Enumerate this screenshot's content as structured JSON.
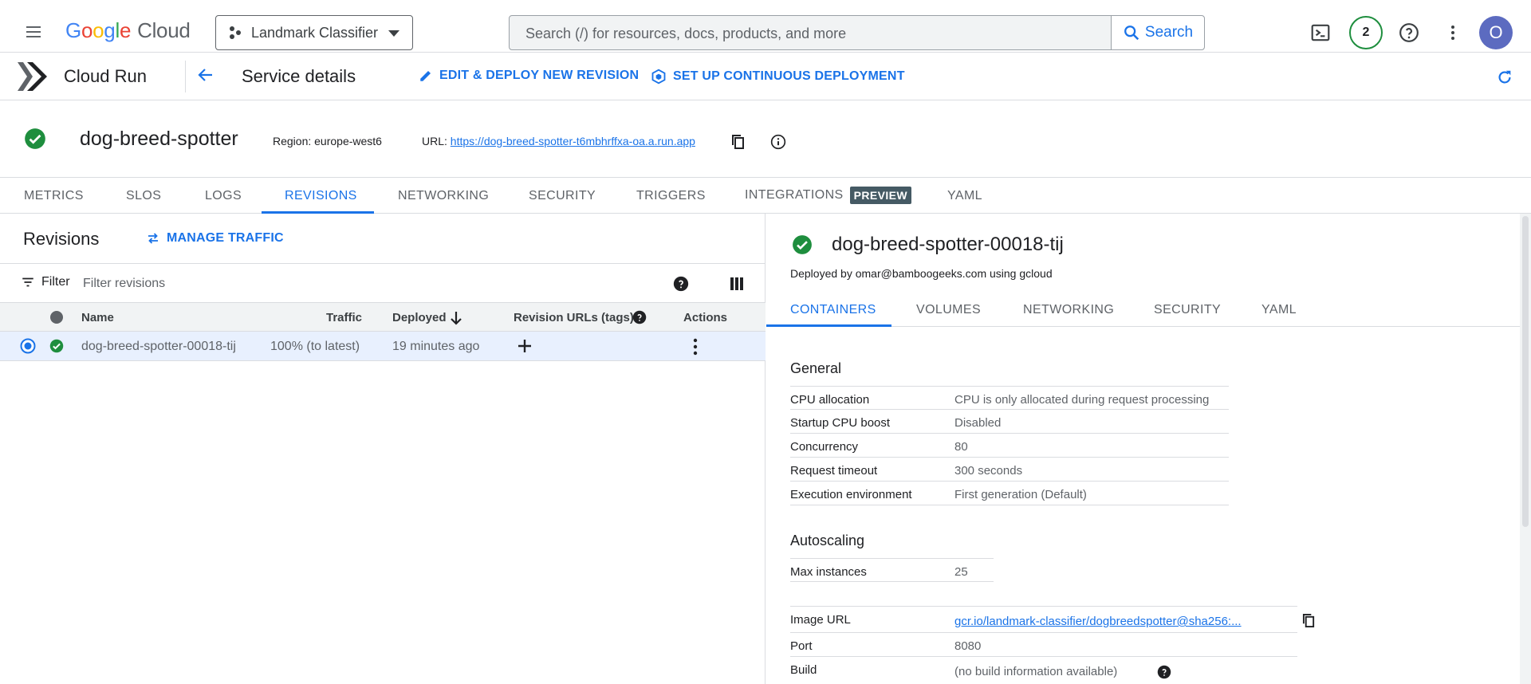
{
  "header": {
    "logo_google": "Google",
    "logo_cloud": "Cloud",
    "project": "Landmark Classifier",
    "search_placeholder": "Search (/) for resources, docs, products, and more",
    "search_button": "Search",
    "notifications_count": "2",
    "avatar_initial": "O"
  },
  "service_bar": {
    "product": "Cloud Run",
    "title": "Service details",
    "edit_action": "EDIT & DEPLOY NEW REVISION",
    "cd_action": "SET UP CONTINUOUS DEPLOYMENT"
  },
  "service": {
    "name": "dog-breed-spotter",
    "region": "Region: europe-west6",
    "url_label": "URL:",
    "url": "https://dog-breed-spotter-t6mbhrffxa-oa.a.run.app"
  },
  "tabs": [
    {
      "label": "METRICS"
    },
    {
      "label": "SLOS"
    },
    {
      "label": "LOGS"
    },
    {
      "label": "REVISIONS"
    },
    {
      "label": "NETWORKING"
    },
    {
      "label": "SECURITY"
    },
    {
      "label": "TRIGGERS"
    },
    {
      "label": "INTEGRATIONS",
      "badge": "PREVIEW"
    },
    {
      "label": "YAML"
    }
  ],
  "revisions": {
    "title": "Revisions",
    "manage_traffic": "MANAGE TRAFFIC",
    "filter_label": "Filter",
    "filter_placeholder": "Filter revisions",
    "columns": {
      "name": "Name",
      "traffic": "Traffic",
      "deployed": "Deployed",
      "urls": "Revision URLs (tags)",
      "actions": "Actions"
    },
    "rows": [
      {
        "name": "dog-breed-spotter-00018-tij",
        "traffic": "100% (to latest)",
        "deployed": "19 minutes ago"
      }
    ]
  },
  "detail": {
    "revision_name": "dog-breed-spotter-00018-tij",
    "deployed_by": "Deployed by omar@bamboogeeks.com using gcloud",
    "subtabs": [
      "CONTAINERS",
      "VOLUMES",
      "NETWORKING",
      "SECURITY",
      "YAML"
    ],
    "general_title": "General",
    "general": [
      {
        "key": "CPU allocation",
        "value": "CPU is only allocated during request processing"
      },
      {
        "key": "Startup CPU boost",
        "value": "Disabled"
      },
      {
        "key": "Concurrency",
        "value": "80"
      },
      {
        "key": "Request timeout",
        "value": "300 seconds"
      },
      {
        "key": "Execution environment",
        "value": "First generation (Default)"
      }
    ],
    "autoscaling_title": "Autoscaling",
    "autoscaling": [
      {
        "key": "Max instances",
        "value": "25"
      }
    ],
    "container": [
      {
        "key": "Image URL",
        "value": "gcr.io/landmark-classifier/dogbreedspotter@sha256:..."
      },
      {
        "key": "Port",
        "value": "8080"
      },
      {
        "key": "Build",
        "value": "(no build information available)"
      }
    ]
  },
  "colors": {
    "accent": "#1a73e8",
    "success": "#1e8e3e",
    "selected_row": "#e8f0fe",
    "preview_badge": "#455a64"
  }
}
